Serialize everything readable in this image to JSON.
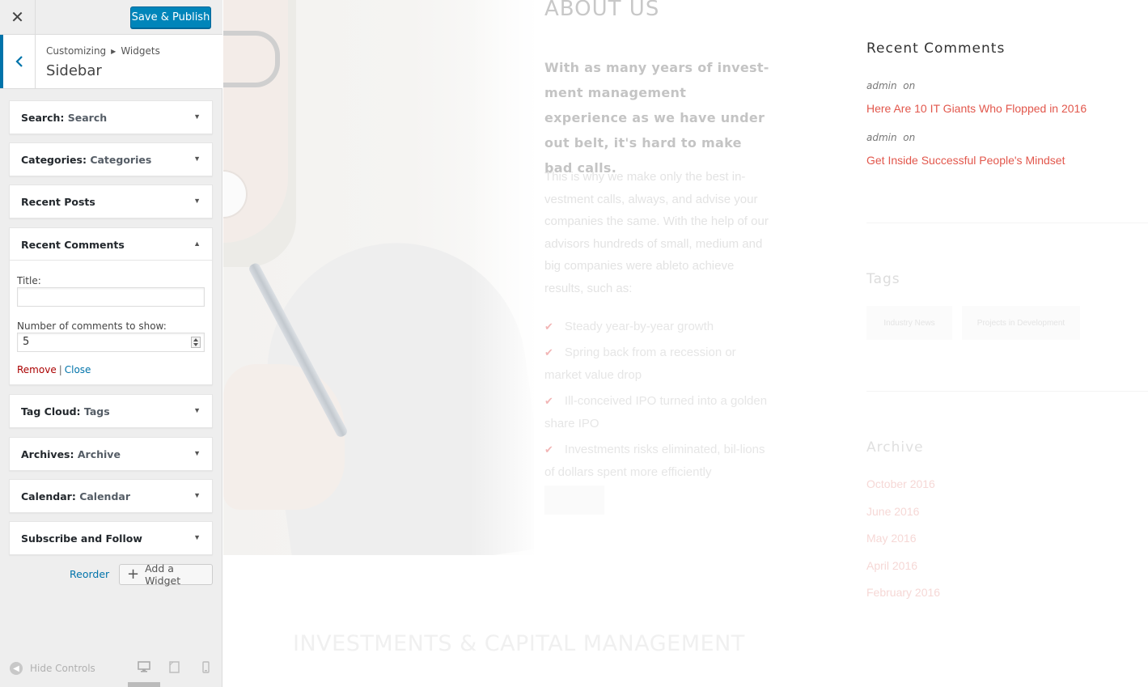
{
  "customizer": {
    "close_icon": "close-icon",
    "publish_label": "Save & Publish",
    "breadcrumb": {
      "root": "Customizing",
      "current": "Widgets"
    },
    "section_title": "Sidebar",
    "widgets": [
      {
        "type": "Search",
        "title": "Search"
      },
      {
        "type": "Categories",
        "title": "Categories"
      },
      {
        "type": "Recent Posts",
        "title": ""
      },
      {
        "type": "Recent Comments",
        "title": "",
        "expanded": true
      },
      {
        "type": "Tag Cloud",
        "title": "Tags"
      },
      {
        "type": "Archives",
        "title": "Archive"
      },
      {
        "type": "Calendar",
        "title": "Calendar"
      },
      {
        "type": "Subscribe and Follow",
        "title": ""
      }
    ],
    "recent_comments_form": {
      "title_label": "Title:",
      "title_value": "",
      "count_label": "Number of comments to show:",
      "count_value": "5",
      "remove_label": "Remove",
      "separator": "|",
      "close_label": "Close"
    },
    "reorder_label": "Reorder",
    "add_widget_label": "Add a Widget",
    "hide_controls_label": "Hide Controls",
    "devices": [
      "desktop",
      "tablet",
      "mobile"
    ],
    "active_device": "desktop"
  },
  "preview": {
    "about": {
      "title": "ABOUT US",
      "lead": "With as many years of invest-ment management experience as we have under out belt, it's hard to make bad calls.",
      "body": "This is why we make only the best in-vestment calls, always, and advise your companies the same.  With the help of our advisors hundreds of small, medium and big companies were ableto achieve results, such as:",
      "list": [
        "Steady year-by-year growth",
        "Spring back from a recession or market value drop",
        "Ill-conceived IPO turned into a golden share IPO",
        "Investments risks eliminated, bil-lions of dollars spent more efficiently"
      ]
    },
    "investments_title": "INVESTMENTS & CAPITAL MANAGEMENT",
    "recent_comments": {
      "title": "Recent Comments",
      "items": [
        {
          "author": "admin",
          "on": "on",
          "post": "Here Are 10 IT Giants Who Flopped in 2016"
        },
        {
          "author": "admin",
          "on": "on",
          "post": "Get Inside Successful People's Mindset"
        }
      ]
    },
    "tags": {
      "title": "Tags",
      "items": [
        "Industry News",
        "Projects in Development"
      ]
    },
    "archive": {
      "title": "Archive",
      "items": [
        "October 2016",
        "June 2016",
        "May 2016",
        "April 2016",
        "February 2016"
      ]
    },
    "colors": {
      "accent": "#e2574c",
      "wp_blue": "#0085ba",
      "link_blue": "#0073aa",
      "remove_red": "#aa0000"
    }
  }
}
